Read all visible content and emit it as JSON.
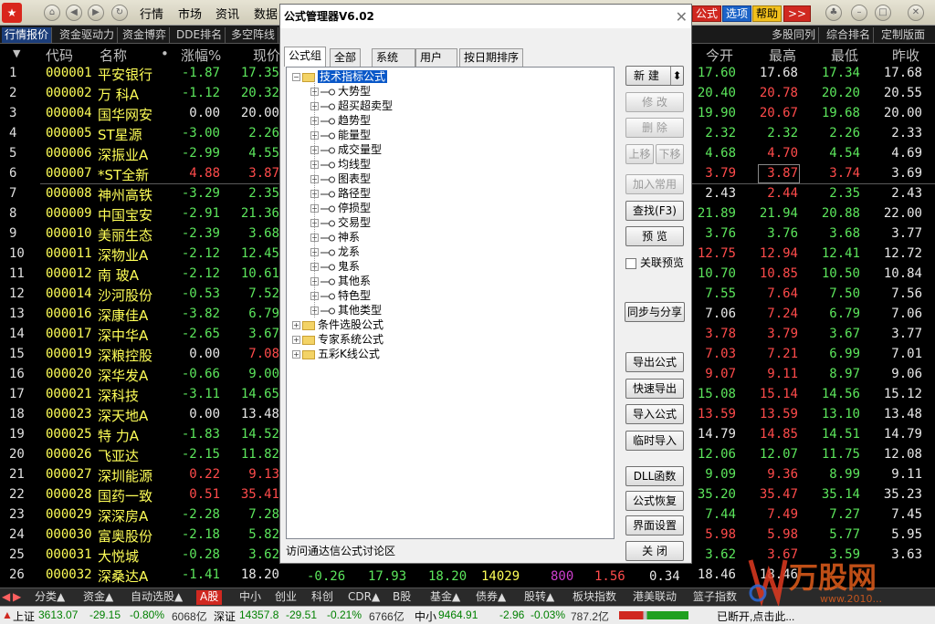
{
  "titlebar": {
    "menus": [
      "行情",
      "市场",
      "资讯",
      "数据"
    ],
    "right_buttons": [
      "公式",
      "选项",
      "帮助",
      ">>"
    ]
  },
  "tabs": {
    "left": [
      "行情报价",
      "资金驱动力",
      "资金博弈",
      "DDE排名",
      "多空阵线"
    ],
    "right": [
      "多股同列",
      "综合排名",
      "定制版面"
    ]
  },
  "columns": [
    "代码",
    "名称",
    "涨幅%",
    "现价",
    "今开",
    "最高",
    "最低",
    "昨收"
  ],
  "columns_note_dot": "•",
  "stocks": [
    {
      "no": "1",
      "code": "000001",
      "name": "平安银行",
      "chg": "-1.87",
      "price": "17.35",
      "open": "17.60",
      "high": "17.68",
      "low": "17.34",
      "prev": "17.68"
    },
    {
      "no": "2",
      "code": "000002",
      "name": "万 科A",
      "chg": "-1.12",
      "price": "20.32",
      "open": "20.40",
      "high": "20.78",
      "low": "20.20",
      "prev": "20.55"
    },
    {
      "no": "3",
      "code": "000004",
      "name": "国华网安",
      "chg": "0.00",
      "price": "20.00",
      "open": "19.90",
      "high": "20.67",
      "low": "19.68",
      "prev": "20.00"
    },
    {
      "no": "4",
      "code": "000005",
      "name": "ST星源",
      "chg": "-3.00",
      "price": "2.26",
      "open": "2.32",
      "high": "2.32",
      "low": "2.26",
      "prev": "2.33"
    },
    {
      "no": "5",
      "code": "000006",
      "name": "深振业A",
      "chg": "-2.99",
      "price": "4.55",
      "open": "4.68",
      "high": "4.70",
      "low": "4.54",
      "prev": "4.69"
    },
    {
      "no": "6",
      "code": "000007",
      "name": "*ST全新",
      "chg": "4.88",
      "price": "3.87",
      "open": "3.79",
      "high": "3.87",
      "low": "3.74",
      "prev": "3.69"
    },
    {
      "no": "7",
      "code": "000008",
      "name": "神州高铁",
      "chg": "-3.29",
      "price": "2.35",
      "open": "2.43",
      "high": "2.44",
      "low": "2.35",
      "prev": "2.43"
    },
    {
      "no": "8",
      "code": "000009",
      "name": "中国宝安",
      "chg": "-2.91",
      "price": "21.36",
      "open": "21.89",
      "high": "21.94",
      "low": "20.88",
      "prev": "22.00"
    },
    {
      "no": "9",
      "code": "000010",
      "name": "美丽生态",
      "chg": "-2.39",
      "price": "3.68",
      "open": "3.76",
      "high": "3.76",
      "low": "3.68",
      "prev": "3.77"
    },
    {
      "no": "10",
      "code": "000011",
      "name": "深物业A",
      "chg": "-2.12",
      "price": "12.45",
      "open": "12.75",
      "high": "12.94",
      "low": "12.41",
      "prev": "12.72"
    },
    {
      "no": "11",
      "code": "000012",
      "name": "南 玻A",
      "chg": "-2.12",
      "price": "10.61",
      "open": "10.70",
      "high": "10.85",
      "low": "10.50",
      "prev": "10.84"
    },
    {
      "no": "12",
      "code": "000014",
      "name": "沙河股份",
      "chg": "-0.53",
      "price": "7.52",
      "open": "7.55",
      "high": "7.64",
      "low": "7.50",
      "prev": "7.56"
    },
    {
      "no": "13",
      "code": "000016",
      "name": "深康佳A",
      "chg": "-3.82",
      "price": "6.79",
      "open": "7.06",
      "high": "7.24",
      "low": "6.79",
      "prev": "7.06"
    },
    {
      "no": "14",
      "code": "000017",
      "name": "深中华A",
      "chg": "-2.65",
      "price": "3.67",
      "open": "3.78",
      "high": "3.79",
      "low": "3.67",
      "prev": "3.77"
    },
    {
      "no": "15",
      "code": "000019",
      "name": "深粮控股",
      "chg": "0.00",
      "price": "7.08",
      "open": "7.03",
      "high": "7.21",
      "low": "6.99",
      "prev": "7.01"
    },
    {
      "no": "16",
      "code": "000020",
      "name": "深华发A",
      "chg": "-0.66",
      "price": "9.00",
      "open": "9.07",
      "high": "9.11",
      "low": "8.97",
      "prev": "9.06"
    },
    {
      "no": "17",
      "code": "000021",
      "name": "深科技",
      "chg": "-3.11",
      "price": "14.65",
      "open": "15.08",
      "high": "15.14",
      "low": "14.56",
      "prev": "15.12"
    },
    {
      "no": "18",
      "code": "000023",
      "name": "深天地A",
      "chg": "0.00",
      "price": "13.48",
      "open": "13.59",
      "high": "13.59",
      "low": "13.10",
      "prev": "13.48"
    },
    {
      "no": "19",
      "code": "000025",
      "name": "特 力A",
      "chg": "-1.83",
      "price": "14.52",
      "open": "14.79",
      "high": "14.85",
      "low": "14.51",
      "prev": "14.79"
    },
    {
      "no": "20",
      "code": "000026",
      "name": "飞亚达",
      "chg": "-2.15",
      "price": "11.82",
      "open": "12.06",
      "high": "12.07",
      "low": "11.75",
      "prev": "12.08"
    },
    {
      "no": "21",
      "code": "000027",
      "name": "深圳能源",
      "chg": "0.22",
      "price": "9.13",
      "open": "9.09",
      "high": "9.36",
      "low": "8.99",
      "prev": "9.11"
    },
    {
      "no": "22",
      "code": "000028",
      "name": "国药一致",
      "chg": "0.51",
      "price": "35.41",
      "open": "35.20",
      "high": "35.47",
      "low": "35.14",
      "prev": "35.23"
    },
    {
      "no": "23",
      "code": "000029",
      "name": "深深房A",
      "chg": "-2.28",
      "price": "7.28",
      "open": "7.44",
      "high": "7.49",
      "low": "7.27",
      "prev": "7.45"
    },
    {
      "no": "24",
      "code": "000030",
      "name": "富奥股份",
      "chg": "-2.18",
      "price": "5.82",
      "open": "5.98",
      "high": "5.98",
      "low": "5.77",
      "prev": "5.95"
    },
    {
      "no": "25",
      "code": "000031",
      "name": "大悦城",
      "chg": "-0.28",
      "price": "3.62",
      "open": "3.62",
      "high": "3.67",
      "low": "3.59",
      "prev": "3.63"
    },
    {
      "no": "26",
      "code": "000032",
      "name": "深桑达A",
      "chg": "-1.41",
      "price": "18.20",
      "open": "18.46",
      "high": "18.46",
      "low": "",
      "prev": ""
    }
  ],
  "row26_extra": [
    "-0.26",
    "17.93",
    "18.20",
    "14029",
    "800",
    "1.56",
    "0.34"
  ],
  "bottom_tabs": [
    "分类▲",
    "资金▲",
    "自动选股▲",
    "A股",
    "中小",
    "创业",
    "科创",
    "CDR▲",
    "B股",
    "基金▲",
    "债券▲",
    "股转▲",
    "板块指数",
    "港美联动",
    "篮子指数"
  ],
  "statusbar": {
    "sh_label": "上证",
    "sh_val": "3613.07",
    "sh_chg": "-29.15",
    "sh_pct": "-0.80%",
    "sh_amt": "6068亿",
    "sz_label": "深证",
    "sz_val": "14357.8",
    "sz_chg": "-29.51",
    "sz_pct": "-0.21%",
    "sz_amt": "6766亿",
    "zx_label": "中小",
    "zx_val": "9464.91",
    "zx_chg": "-2.96",
    "zx_pct": "-0.03%",
    "zx_amt": "787.2亿",
    "msg": "已断开,点击此..."
  },
  "dialog": {
    "title": "公式管理器V6.02",
    "tabs": [
      "公式组",
      "全部",
      "系统",
      "用户",
      "按日期排序"
    ],
    "tree": {
      "root": "技术指标公式",
      "children": [
        "大势型",
        "超买超卖型",
        "趋势型",
        "能量型",
        "成交量型",
        "均线型",
        "图表型",
        "路径型",
        "停损型",
        "交易型",
        "神系",
        "龙系",
        "鬼系",
        "其他系",
        "特色型",
        "其他类型"
      ],
      "siblings": [
        "条件选股公式",
        "专家系统公式",
        "五彩K线公式"
      ]
    },
    "buttons": {
      "new": "新 建",
      "modify": "修 改",
      "delete": "删 除",
      "up": "上移",
      "down": "下移",
      "add_common": "加入常用",
      "find": "查找(F3)",
      "preview": "预 览",
      "link_preview": "关联预览",
      "sync_share": "同步与分享",
      "export": "导出公式",
      "quick_export": "快速导出",
      "import": "导入公式",
      "temp_import": "临时导入",
      "dll": "DLL函数",
      "restore": "公式恢复",
      "ui_settings": "界面设置",
      "close": "关 闭"
    },
    "footer": "访问通达信公式讨论区"
  },
  "watermark": {
    "brand": "万股网",
    "url": "www.2010..."
  },
  "colors": {
    "up": "#ff4b4b",
    "down": "#5ce65c",
    "code": "#ffff58",
    "neutral": "#e8e8e8"
  }
}
